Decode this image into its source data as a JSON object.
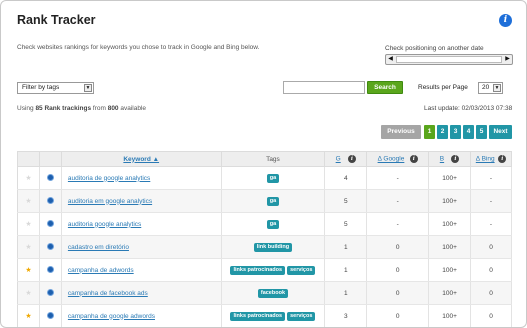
{
  "header": {
    "title": "Rank Tracker",
    "description": "Check websites rankings for keywords you chose to track in Google and Bing below.",
    "info_icon": "info-icon",
    "info_glyph": "i"
  },
  "positioning": {
    "label": "Check positioning on another date",
    "left_arrow": "◀",
    "right_arrow": "▶"
  },
  "filter": {
    "value": "Filter by tags",
    "arrow": "▼"
  },
  "search": {
    "placeholder": "",
    "button_label": "Search"
  },
  "results_per_page": {
    "label": "Results per Page",
    "value": "20",
    "arrow": "▼"
  },
  "usage": {
    "prefix": "Using",
    "used": "85 Rank trackings",
    "middle": "from",
    "total": "800",
    "suffix": "available"
  },
  "last_update": "Last update: 02/03/2013 07:38",
  "pagination": {
    "previous": "Previous",
    "pages": [
      "1",
      "2",
      "3",
      "4",
      "5"
    ],
    "current": "1",
    "next": "Next"
  },
  "table": {
    "headers": {
      "keyword": "Keyword ▲",
      "tags": "Tags",
      "g": "G",
      "delta_google": "Δ Google",
      "b": "B",
      "delta_bing": "Δ Bing"
    },
    "header_info_glyph": "i",
    "star_glyph": "★",
    "rows": [
      {
        "starred": false,
        "keyword": "auditoria de google analytics",
        "tags": [
          "ga"
        ],
        "g": "4",
        "dg": "-",
        "b": "100+",
        "db": "-"
      },
      {
        "starred": false,
        "keyword": "auditoria em google analytics",
        "tags": [
          "ga"
        ],
        "g": "5",
        "dg": "-",
        "b": "100+",
        "db": "-"
      },
      {
        "starred": false,
        "keyword": "auditoria google analytics",
        "tags": [
          "ga"
        ],
        "g": "5",
        "dg": "-",
        "b": "100+",
        "db": "-"
      },
      {
        "starred": false,
        "keyword": "cadastro em diretório",
        "tags": [
          "link building"
        ],
        "g": "1",
        "dg": "0",
        "b": "100+",
        "db": "0"
      },
      {
        "starred": true,
        "keyword": "campanha de adwords",
        "tags": [
          "links patrocinados",
          "serviços"
        ],
        "g": "1",
        "dg": "0",
        "b": "100+",
        "db": "0"
      },
      {
        "starred": false,
        "keyword": "campanha de facebook ads",
        "tags": [
          "facebook"
        ],
        "g": "1",
        "dg": "0",
        "b": "100+",
        "db": "0"
      },
      {
        "starred": true,
        "keyword": "campanha de google adwords",
        "tags": [
          "links patrocinados",
          "serviços"
        ],
        "g": "3",
        "dg": "0",
        "b": "100+",
        "db": "0"
      }
    ]
  },
  "colors": {
    "accent": "#2196a6",
    "search_green": "#5aa61c",
    "link": "#2a7ab5",
    "star_on": "#f0a800"
  }
}
